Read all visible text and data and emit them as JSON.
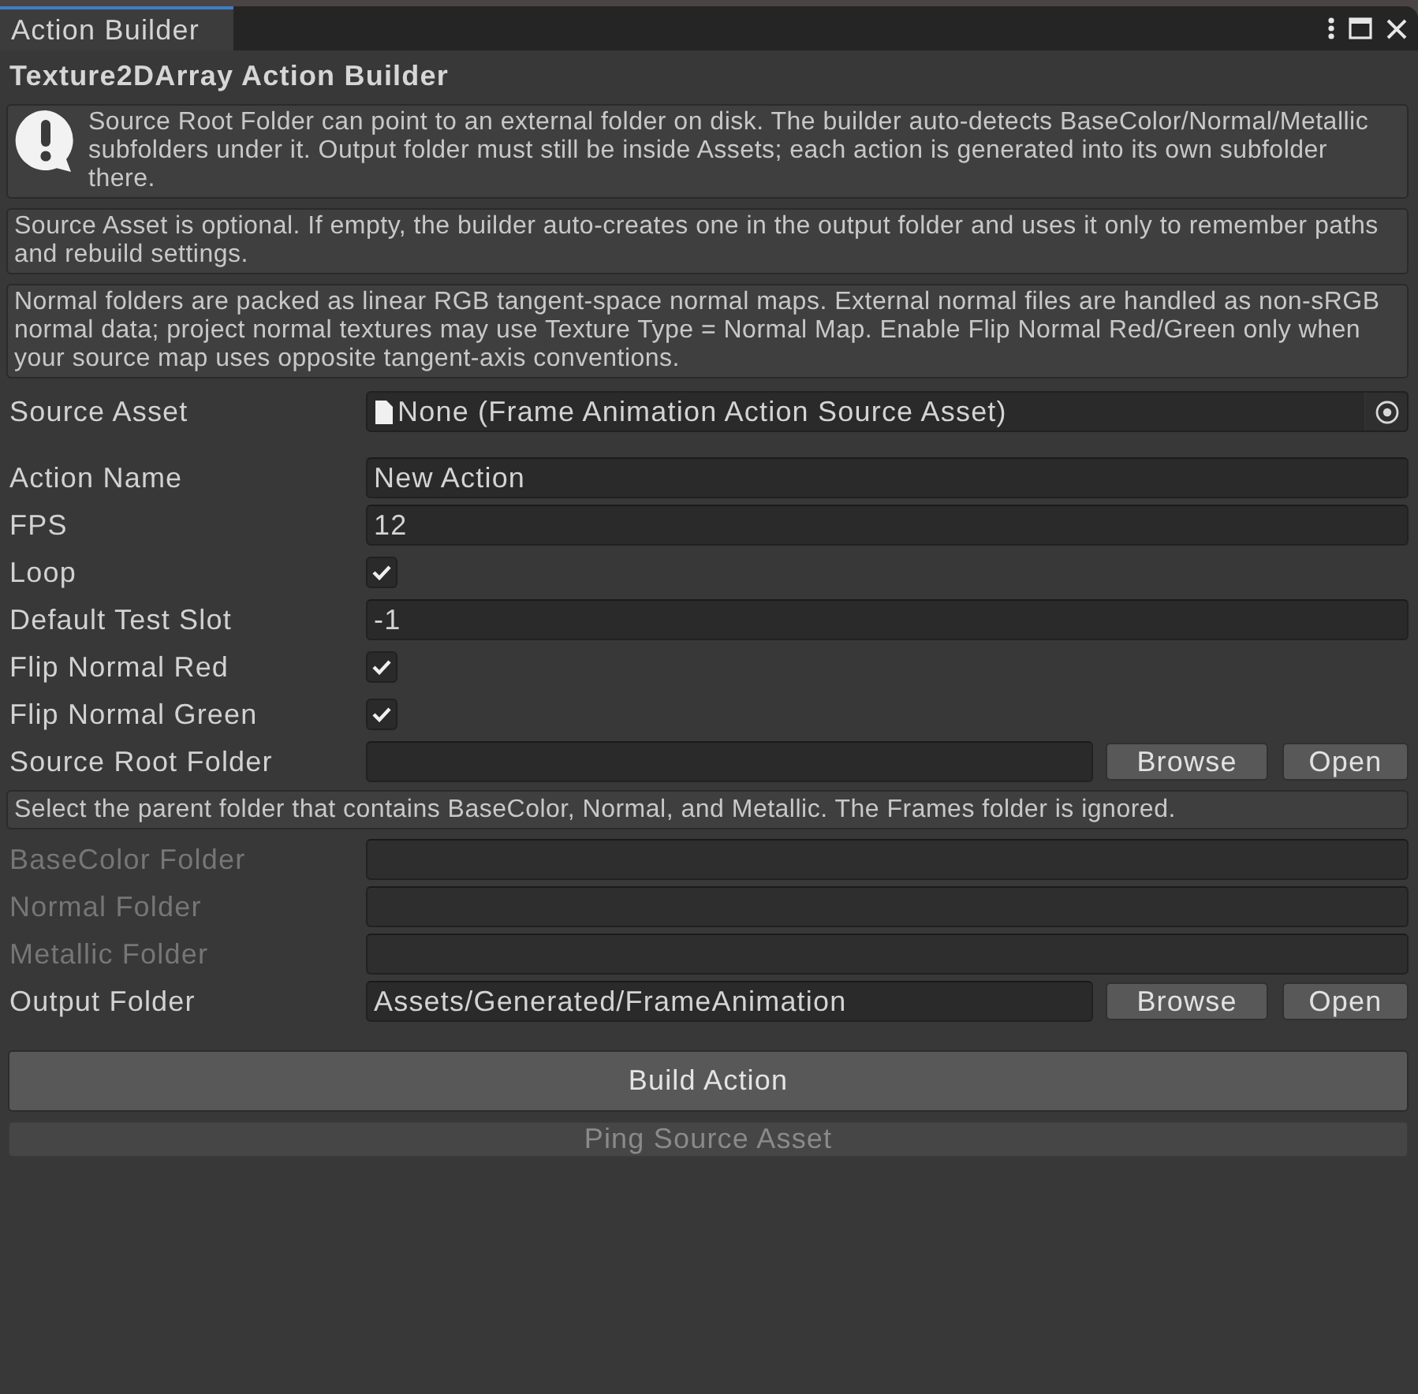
{
  "window": {
    "tab": {
      "title": "Action Builder",
      "selected": true
    }
  },
  "heading": "Texture2DArray Action Builder",
  "help_boxes": [
    {
      "kind": "warning",
      "text": "Source Root Folder can point to an external folder on disk. The builder auto-detects BaseColor/Normal/Metallic subfolders under it. Output folder must still be inside Assets; each action is generated into its own subfolder there."
    },
    {
      "kind": "plain",
      "text": "Source Asset is optional. If empty, the builder auto-creates one in the output folder and uses it only to remember paths and rebuild settings."
    },
    {
      "kind": "plain",
      "text": "Normal folders are packed as linear RGB tangent-space normal maps. External normal files are handled as non-sRGB normal data; project normal textures may use Texture Type = Normal Map. Enable Flip Normal Red/Green only when your source map uses opposite tangent-axis conventions."
    }
  ],
  "fields": [
    {
      "kind": "object",
      "label": "Source Asset",
      "value": "None (Frame Animation Action Source Asset)",
      "disabled": false
    },
    {
      "kind": "text",
      "label": "Action Name",
      "value": "New Action",
      "disabled": false
    },
    {
      "kind": "text",
      "label": "FPS",
      "value": "12",
      "disabled": false
    },
    {
      "kind": "checkbox",
      "label": "Loop",
      "checked": true,
      "disabled": false
    },
    {
      "kind": "text",
      "label": "Default Test Slot",
      "value": "-1",
      "disabled": false
    },
    {
      "kind": "checkbox",
      "label": "Flip Normal Red",
      "checked": true,
      "disabled": false
    },
    {
      "kind": "checkbox",
      "label": "Flip Normal Green",
      "checked": true,
      "disabled": false
    },
    {
      "kind": "folder",
      "label": "Source Root Folder",
      "buttons": [
        "Browse",
        "Open"
      ],
      "disabled": false
    },
    {
      "kind": "note",
      "text": "Select the parent folder that contains BaseColor, Normal, and Metallic. The Frames folder is ignored.",
      "disabled": false
    },
    {
      "kind": "text",
      "label": "BaseColor Folder",
      "disabled": true
    },
    {
      "kind": "text",
      "label": "Normal Folder",
      "disabled": true
    },
    {
      "kind": "text",
      "label": "Metallic Folder",
      "disabled": true
    },
    {
      "kind": "folder",
      "label": "Output Folder",
      "value": "Assets/Generated/FrameAnimation",
      "buttons": [
        "Browse",
        "Open"
      ],
      "disabled": false
    }
  ],
  "buttons": [
    {
      "label": "Build Action",
      "kind": "large",
      "disabled": false
    },
    {
      "label": "Ping Source Asset",
      "kind": "small",
      "disabled": true
    }
  ]
}
